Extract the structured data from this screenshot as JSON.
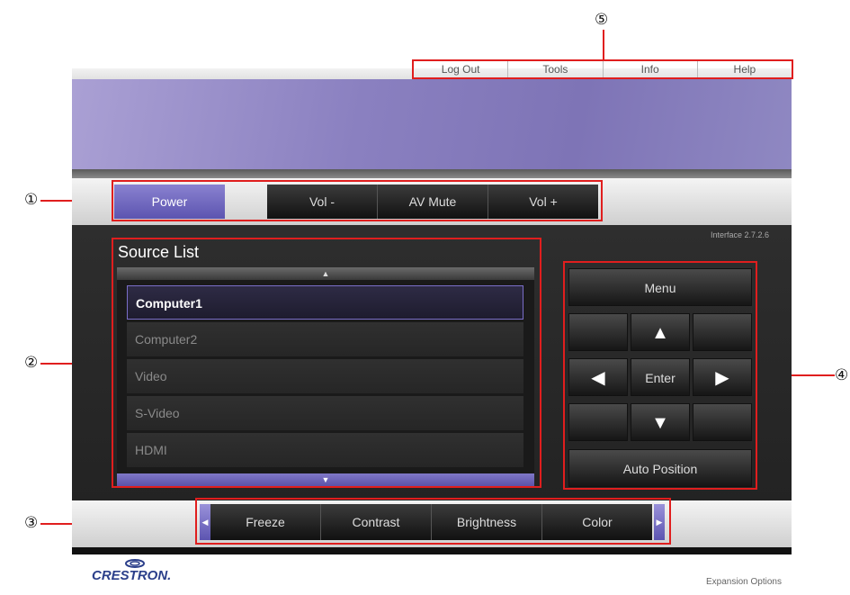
{
  "callouts": {
    "one": "①",
    "two": "②",
    "three": "③",
    "four": "④",
    "five": "⑤"
  },
  "topnav": {
    "items": [
      "Log Out",
      "Tools",
      "Info",
      "Help"
    ]
  },
  "control": {
    "power": "Power",
    "vol_down": "Vol -",
    "av_mute": "AV Mute",
    "vol_up": "Vol +"
  },
  "interface_version": "Interface 2.7.2.6",
  "source_list": {
    "title": "Source List",
    "scroll_up": "▲",
    "scroll_down": "▼",
    "items": [
      "Computer1",
      "Computer2",
      "Video",
      "S-Video",
      "HDMI"
    ],
    "selected": "Computer1"
  },
  "nav": {
    "menu": "Menu",
    "up": "▲",
    "left": "◀",
    "enter": "Enter",
    "right": "▶",
    "down": "▼",
    "auto_position": "Auto Position"
  },
  "expansion": {
    "left_arrow": "◀",
    "right_arrow": "▶",
    "items": [
      "Freeze",
      "Contrast",
      "Brightness",
      "Color"
    ]
  },
  "footer": {
    "logo_text": "CRESTRON.",
    "expansion_options": "Expansion Options"
  },
  "colors": {
    "accent": "#6a62c0",
    "highlight_border": "#e01e1e",
    "background": "#ffffff"
  },
  "icons": [
    "crestron-logo-icon",
    "arrow-up-icon",
    "arrow-down-icon",
    "arrow-left-icon",
    "arrow-right-icon"
  ]
}
